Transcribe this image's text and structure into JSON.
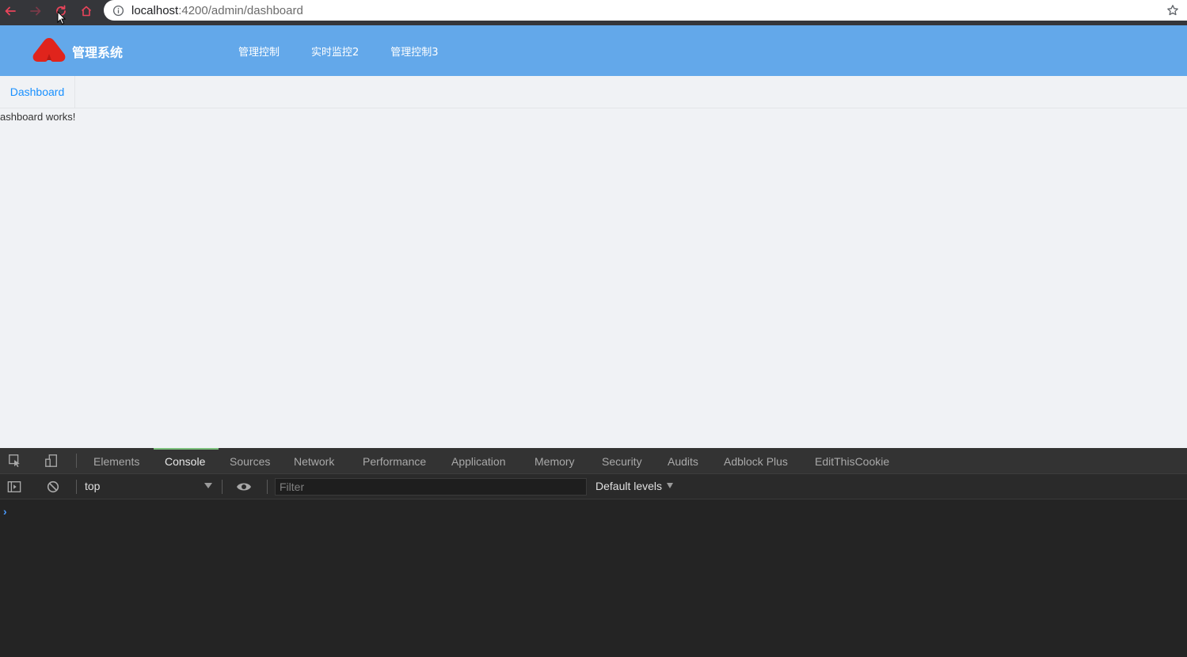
{
  "browser": {
    "url_host": "localhost",
    "url_path": ":4200/admin/dashboard",
    "back_icon": "arrow-left-icon",
    "forward_icon": "arrow-right-icon",
    "reload_icon": "reload-icon",
    "home_icon": "home-icon",
    "star_icon": "star-icon",
    "accent_color": "#e8445a"
  },
  "header": {
    "brand": "管理系统",
    "brand_color": "#63a8ea",
    "logo_color": "#e0241c",
    "nav": [
      "管理控制",
      "实时监控2",
      "管理控制3"
    ]
  },
  "tabs": [
    {
      "label": "Dashboard",
      "active": true
    }
  ],
  "content": {
    "text": "ashboard works!"
  },
  "devtools": {
    "tabs": [
      "Elements",
      "Console",
      "Sources",
      "Network",
      "Performance",
      "Application",
      "Memory",
      "Security",
      "Audits",
      "Adblock Plus",
      "EditThisCookie"
    ],
    "active_tab": "Console",
    "context": "top",
    "filter_placeholder": "Filter",
    "levels": "Default levels",
    "prompt": "›"
  }
}
